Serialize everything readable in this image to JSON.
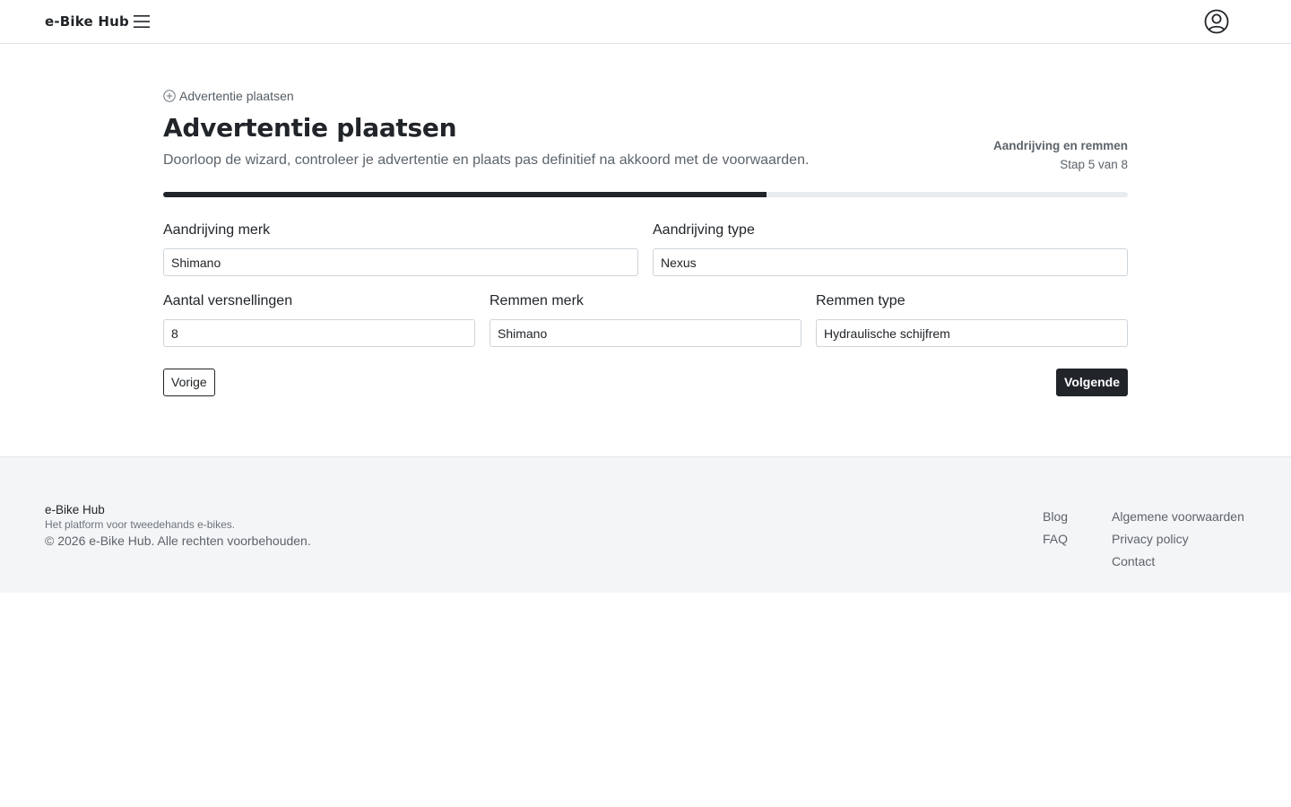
{
  "header": {
    "brand": "e-Bike Hub",
    "menu_icon": "hamburger-menu-icon",
    "account_icon": "user-circle-icon"
  },
  "page": {
    "breadcrumb_icon": "plus-circle-icon",
    "breadcrumb": "Advertentie plaatsen",
    "title": "Advertentie plaatsen",
    "lead": "Doorloop de wizard, controleer je advertentie en plaats pas definitief na akkoord met de voorwaarden.",
    "step_name": "Aandrijving en remmen",
    "step_counter": "Stap 5 van 8",
    "progress_percent": 62.5
  },
  "form": {
    "drive_brand": {
      "label": "Aandrijving merk",
      "value": "Shimano"
    },
    "drive_type": {
      "label": "Aandrijving type",
      "value": "Nexus"
    },
    "gears": {
      "label": "Aantal versnellingen",
      "value": "8"
    },
    "brake_brand": {
      "label": "Remmen merk",
      "value": "Shimano"
    },
    "brake_type": {
      "label": "Remmen type",
      "value": "Hydraulische schijfrem"
    }
  },
  "actions": {
    "prev": "Vorige",
    "next": "Volgende"
  },
  "footer": {
    "brand": "e-Bike Hub",
    "tagline": "Het platform voor tweedehands e-bikes.",
    "copyright": "© 2026 e-Bike Hub. Alle rechten voorbehouden.",
    "links_col1": [
      "Blog",
      "FAQ"
    ],
    "links_col2": [
      "Algemene voorwaarden",
      "Privacy policy",
      "Contact"
    ]
  },
  "colors": {
    "primary": "#212529",
    "muted": "#5c636a",
    "progress_track": "#e9ecef",
    "footer_bg": "#f4f5f7"
  }
}
